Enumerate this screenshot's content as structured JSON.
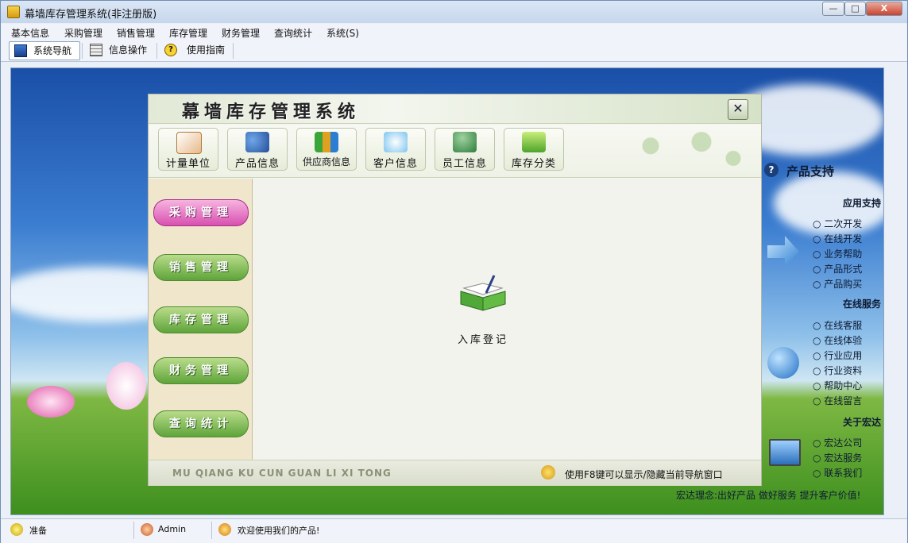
{
  "window": {
    "title": "幕墙库存管理系统(非注册版)",
    "controls": {
      "minimize": "—",
      "maximize": "□",
      "close": "X"
    }
  },
  "menu": [
    "基本信息",
    "采购管理",
    "销售管理",
    "库存管理",
    "财务管理",
    "查询统计",
    "系统(S)"
  ],
  "toolbar": {
    "tabs": [
      {
        "label": "系统导航",
        "icon": "monitor-icon",
        "active": true
      },
      {
        "label": "信息操作",
        "icon": "grid-icon",
        "active": false
      },
      {
        "label": "使用指南",
        "icon": "help-icon",
        "active": false
      }
    ]
  },
  "dialog": {
    "title": "幕墙库存管理系统",
    "close": "✕",
    "top_buttons": [
      {
        "label": "计量单位",
        "icon": "book-icon"
      },
      {
        "label": "产品信息",
        "icon": "users-icon"
      },
      {
        "label": "供应商信息",
        "icon": "chart-icon"
      },
      {
        "label": "客户信息",
        "icon": "handshake-icon"
      },
      {
        "label": "员工信息",
        "icon": "people-icon"
      },
      {
        "label": "库存分类",
        "icon": "folder-icon"
      }
    ],
    "left_nav": [
      {
        "label": "采购管理",
        "selected": true
      },
      {
        "label": "销售管理",
        "selected": false
      },
      {
        "label": "库存管理",
        "selected": false
      },
      {
        "label": "财务管理",
        "selected": false
      },
      {
        "label": "查询统计",
        "selected": false
      }
    ],
    "workspace_item": {
      "label": "入库登记",
      "icon": "open-book-icon"
    },
    "footer_pinyin": "MU QIANG KU CUN  GUAN LI XI TONG",
    "footer_tip": "使用F8键可以显示/隐藏当前导航窗口"
  },
  "right_panel": {
    "header": "产品支持",
    "sections": [
      {
        "title": "应用支持",
        "items": [
          "二次开发",
          "在线开发",
          "业务帮助",
          "产品形式",
          "产品购买"
        ]
      },
      {
        "title": "在线服务",
        "items": [
          "在线客服",
          "在线体验",
          "行业应用",
          "行业资料",
          "帮助中心",
          "在线留言"
        ]
      },
      {
        "title": "关于宏达",
        "items": [
          "宏达公司",
          "宏达服务",
          "联系我们"
        ]
      }
    ],
    "slogan": "宏达理念:出好产品 做好服务 提升客户价值!"
  },
  "statusbar": {
    "ready": "准备",
    "user": "Admin",
    "message": "欢迎使用我们的产品!"
  }
}
